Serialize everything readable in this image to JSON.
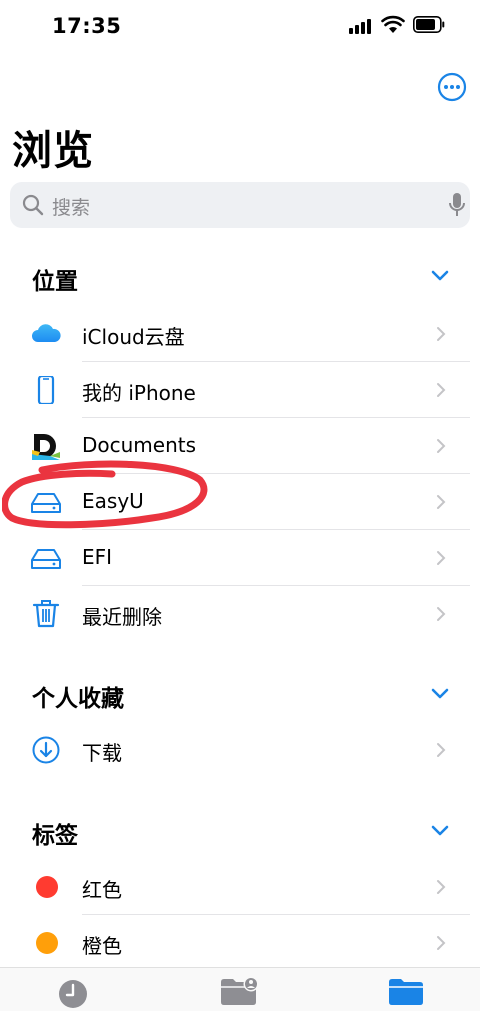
{
  "status_bar": {
    "time": "17:35"
  },
  "page_title": "浏览",
  "search": {
    "placeholder": "搜索"
  },
  "sections": {
    "locations": {
      "title": "位置"
    },
    "favorites": {
      "title": "个人收藏"
    },
    "tags": {
      "title": "标签"
    }
  },
  "locations": [
    {
      "label": "iCloud云盘",
      "icon": "icloud-icon"
    },
    {
      "label": "我的 iPhone",
      "icon": "iphone-icon"
    },
    {
      "label": "Documents",
      "icon": "documents-app-icon"
    },
    {
      "label": "EasyU",
      "icon": "external-drive-icon"
    },
    {
      "label": "EFI",
      "icon": "external-drive-icon"
    },
    {
      "label": "最近删除",
      "icon": "trash-icon"
    }
  ],
  "favorites": [
    {
      "label": "下载",
      "icon": "download-icon"
    }
  ],
  "tags": [
    {
      "label": "红色",
      "color": "#ff3b30"
    },
    {
      "label": "橙色",
      "color": "#ff9f0a"
    }
  ],
  "tabbar": {
    "items": [
      {
        "icon": "clock-icon",
        "selected": false
      },
      {
        "icon": "shared-folder-icon",
        "selected": false
      },
      {
        "icon": "folder-icon",
        "selected": true
      }
    ]
  },
  "colors": {
    "accent": "#1a84e6",
    "annotation": "#e8232f"
  }
}
